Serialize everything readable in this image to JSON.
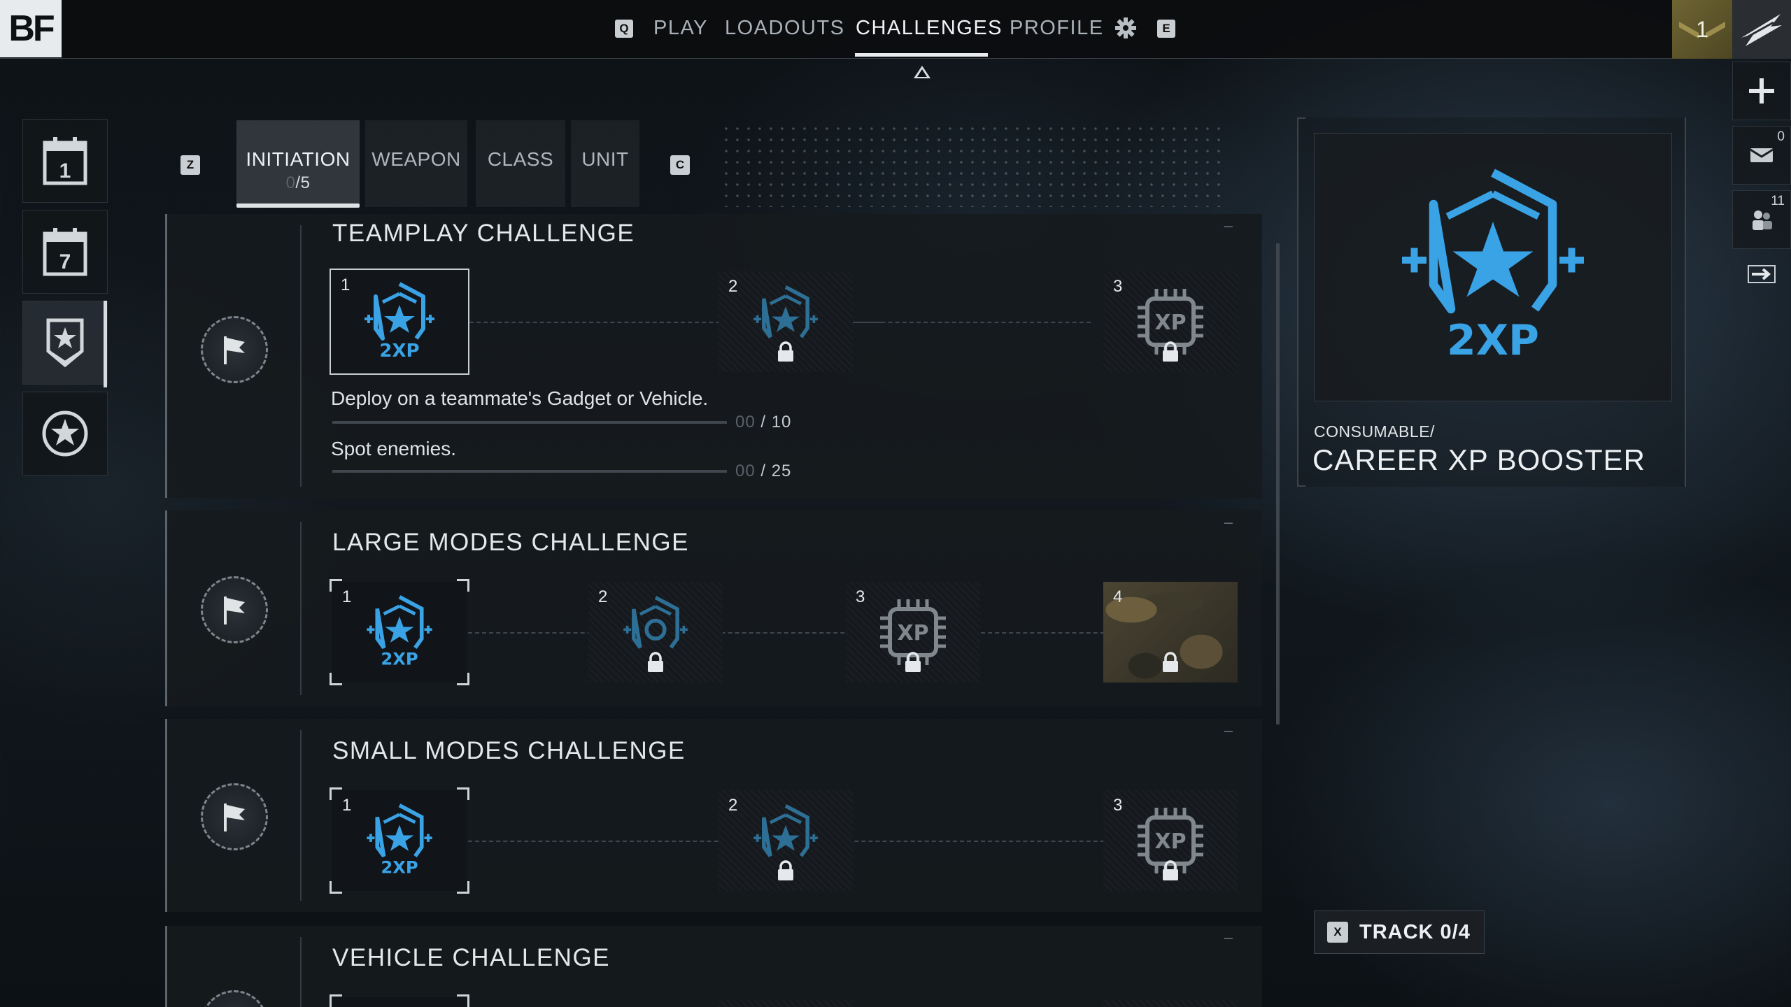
{
  "logo": "BF",
  "nav": {
    "key_left": "Q",
    "items": [
      "PLAY",
      "LOADOUTS",
      "CHALLENGES",
      "PROFILE"
    ],
    "active": "CHALLENGES",
    "key_right": "E",
    "settings_icon": "gear-icon"
  },
  "player": {
    "rank": "1"
  },
  "right_bar": {
    "mail_count": "0",
    "squad_count": "11"
  },
  "left_sidebar": [
    "calendar-day-icon",
    "calendar-week-icon",
    "shield-star-icon",
    "star-circle-icon"
  ],
  "left_sidebar_labels": {
    "day": "1",
    "week": "7"
  },
  "tabs": {
    "key_left": "Z",
    "key_right": "C",
    "items": [
      {
        "label": "INITIATION",
        "progress_done": "0",
        "progress_total": "/5"
      },
      {
        "label": "WEAPON"
      },
      {
        "label": "CLASS"
      },
      {
        "label": "UNIT"
      }
    ]
  },
  "challenges": [
    {
      "title": "TEAMPLAY CHALLENGE",
      "rewards": [
        "1",
        "2",
        "3"
      ],
      "objectives": [
        {
          "text": "Deploy on a teammate's Gadget or Vehicle.",
          "current": "00",
          "total": "/ 10"
        },
        {
          "text": "Spot enemies.",
          "current": "00",
          "total": "/ 25"
        }
      ]
    },
    {
      "title": "LARGE MODES CHALLENGE",
      "rewards": [
        "1",
        "2",
        "3",
        "4"
      ]
    },
    {
      "title": "SMALL MODES CHALLENGE",
      "rewards": [
        "1",
        "2",
        "3"
      ]
    },
    {
      "title": "VEHICLE CHALLENGE",
      "rewards": []
    }
  ],
  "reward_badge_text": "2XP",
  "xp_chip_text": "XP",
  "detail": {
    "type": "CONSUMABLE/",
    "name": "CAREER XP BOOSTER",
    "badge_text": "2XP"
  },
  "track": {
    "key": "X",
    "label": "TRACK 0/4"
  },
  "colors": {
    "accent_blue": "#3aa3e6",
    "locked_blue": "#2e6f95"
  }
}
